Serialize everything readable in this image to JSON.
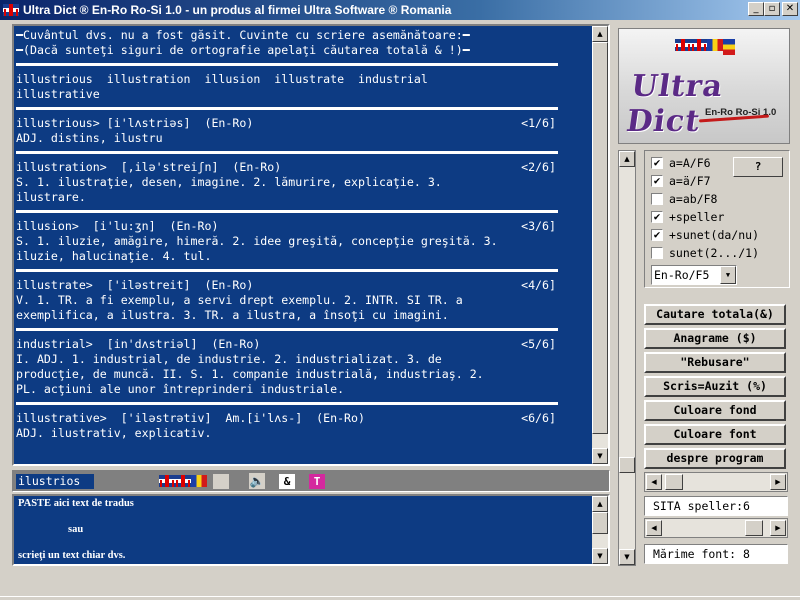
{
  "window": {
    "title": "Ultra Dict ® En-Ro Ro-Si 1.0 - un produs al firmei Ultra Software ® Romania",
    "minimize": "_",
    "maximize": "▫",
    "close": "✕"
  },
  "results": {
    "header_lines": [
      "━Cuvântul dvs. nu a fost găsit. Cuvinte cu scriere asemănătoare:━",
      "━(Dacă sunteţi siguri de ortografie apelaţi căutarea totală & !)━"
    ],
    "suggestions_line1": "illustrious  illustration  illusion  illustrate  industrial",
    "suggestions_line2": "illustrative",
    "entries": [
      {
        "head": "illustrious> [i'lʌstriəs]  (En-Ro)",
        "index": "<1/6]",
        "lines": [
          "ADJ. distins, ilustru"
        ]
      },
      {
        "head": "illustration>  [,ilə'streiʃn]  (En-Ro)",
        "index": "<2/6]",
        "lines": [
          "S. 1. ilustraţie, desen, imagine. 2. lămurire, explicaţie. 3.",
          "ilustrare."
        ]
      },
      {
        "head": "illusion>  [i'lu:ʒn]  (En-Ro)",
        "index": "<3/6]",
        "lines": [
          "S. 1. iluzie, amăgire, himeră. 2. idee greşită, concepţie greşită. 3.",
          "iluzie, halucinaţie. 4. tul."
        ]
      },
      {
        "head": "illustrate>  ['iləstreit]  (En-Ro)",
        "index": "<4/6]",
        "lines": [
          "V. 1. TR. a fi exemplu, a servi drept exemplu. 2. INTR. SI TR. a",
          "exemplifica, a ilustra. 3. TR. a ilustra, a însoţi cu imagini."
        ]
      },
      {
        "head": "industrial>  [in'dʌstriəl]  (En-Ro)",
        "index": "<5/6]",
        "lines": [
          "I. ADJ. 1. industrial, de industrie. 2. industrializat. 3. de",
          "producţie, de muncă. II. S. 1. companie industrială, industriaş. 2.",
          "PL. acţiuni ale unor întreprinderi industriale."
        ]
      },
      {
        "head": "illustrative>  ['iləstrətiv]  Am.[i'lʌs-]  (En-Ro)",
        "index": "<6/6]",
        "lines": [
          "ADJ. ilustrativ, explicativ."
        ]
      }
    ]
  },
  "input": {
    "value": "ilustrios",
    "speaker_icon": "🔈",
    "amp_label": "&",
    "t_label": "T"
  },
  "paste_area": {
    "line1": "PASTE aici text de tradus",
    "line2": "sau",
    "line3": "scrieţi un text chiar dvs."
  },
  "logo": {
    "brand": "Ultra Dict",
    "version": "En-Ro Ro-Si 1.0"
  },
  "options": [
    {
      "label": "a=A/F6",
      "checked": true
    },
    {
      "label": "a=ä/F7",
      "checked": true
    },
    {
      "label": "a=ab/F8",
      "checked": false
    },
    {
      "label": "+speller",
      "checked": true
    },
    {
      "label": "+sunet(da/nu)",
      "checked": true
    },
    {
      "label": "sunet(2.../1)",
      "checked": false
    }
  ],
  "help_button": "?",
  "direction_select": "En-Ro/F5",
  "action_buttons": [
    "Cautare totala(&)",
    "Anagrame ($)",
    "\"Rebusare\"",
    "Scris=Auzit (%)",
    "Culoare fond",
    "Culoare font",
    "despre program"
  ],
  "speller_field": "SITA speller:6",
  "font_size_field": "Mărime font: 8",
  "colors": {
    "panel_blue": "#0d3b83",
    "chrome": "#d4d0c8",
    "title_blue": "#0a246a"
  }
}
